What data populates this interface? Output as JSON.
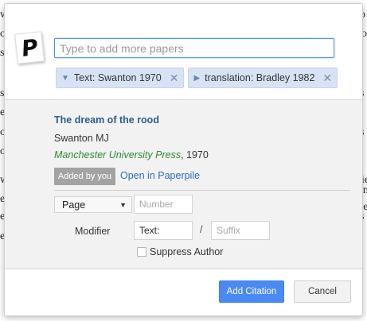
{
  "background_fragments": [
    "w",
    "o",
    "o",
    "o",
    "s",
    "s",
    "el",
    "o",
    "s",
    "o",
    "w",
    "ie",
    "e",
    "el",
    "s",
    "el",
    "s",
    "in",
    "ee"
  ],
  "search": {
    "placeholder": "Type to add more papers"
  },
  "chips": [
    {
      "label": "Text: Swanton 1970",
      "remove_glyph": "✕"
    },
    {
      "label": "translation: Bradley 1982",
      "remove_glyph": "✕"
    }
  ],
  "paper": {
    "title": "The dream of the rood",
    "author": "Swanton MJ",
    "journal": "Manchester University Press",
    "year": ", 1970",
    "added_badge": "Added by you",
    "open_link": "Open in Paperpile"
  },
  "citation": {
    "locator_type": "Page",
    "number_placeholder": "Number",
    "modifier_label": "Modifier",
    "text_value": "Text:",
    "slash": "/",
    "suffix_placeholder": "Suffix",
    "suppress_label": "Suppress Author"
  },
  "footer": {
    "add_label": "Add Citation",
    "cancel_label": "Cancel"
  },
  "colors": {
    "accent": "#4a8af4",
    "title": "#2a5d8c",
    "journal": "#2e8b2e",
    "chip": "#d7e3f4"
  }
}
